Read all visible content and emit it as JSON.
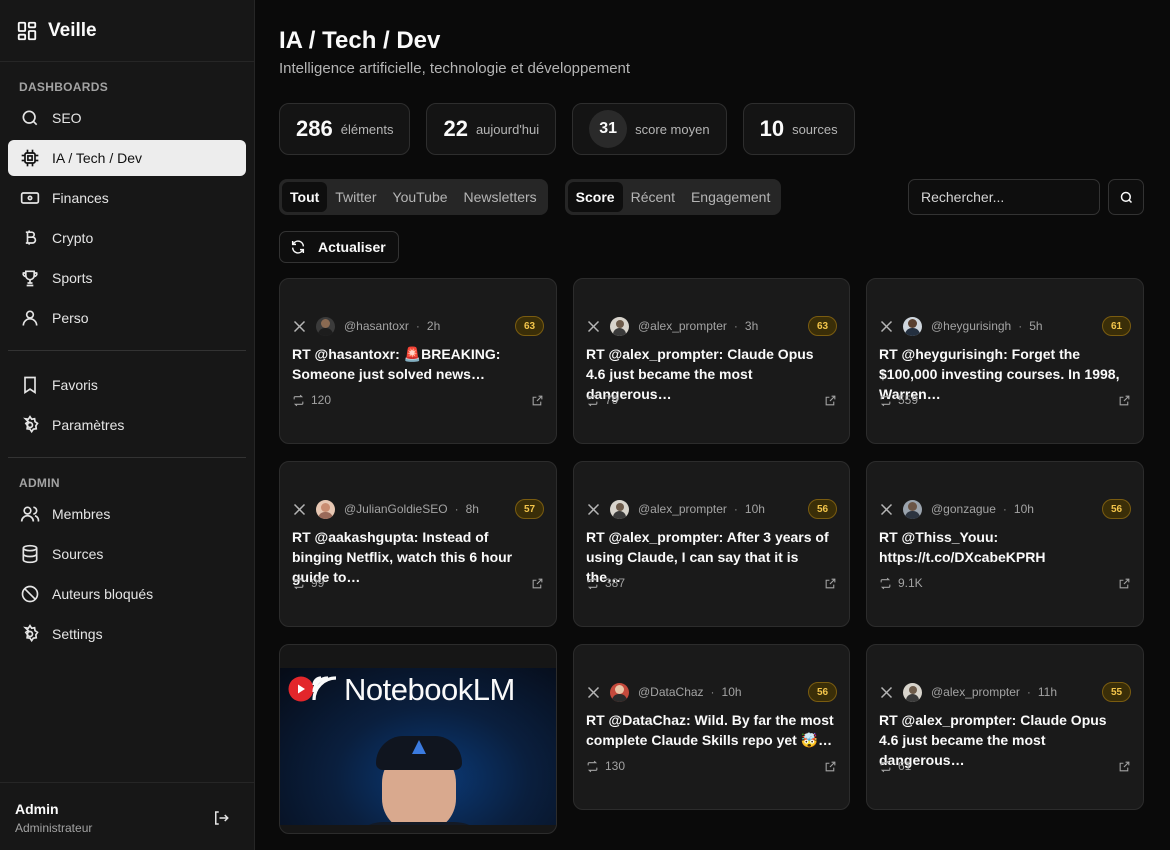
{
  "brand": {
    "name": "Veille"
  },
  "sidebar": {
    "dashboards_label": "DASHBOARDS",
    "dashboards": [
      {
        "label": "SEO",
        "icon": "search-icon"
      },
      {
        "label": "IA / Tech / Dev",
        "icon": "chip-icon",
        "active": true
      },
      {
        "label": "Finances",
        "icon": "banknote-icon"
      },
      {
        "label": "Crypto",
        "icon": "bitcoin-icon"
      },
      {
        "label": "Sports",
        "icon": "trophy-icon"
      },
      {
        "label": "Perso",
        "icon": "user-icon"
      }
    ],
    "other": [
      {
        "label": "Favoris",
        "icon": "bookmark-icon"
      },
      {
        "label": "Paramètres",
        "icon": "settings-icon"
      }
    ],
    "admin_label": "ADMIN",
    "admin": [
      {
        "label": "Membres",
        "icon": "users-icon"
      },
      {
        "label": "Sources",
        "icon": "database-icon"
      },
      {
        "label": "Auteurs bloqués",
        "icon": "ban-icon"
      },
      {
        "label": "Settings",
        "icon": "settings-icon"
      }
    ],
    "user": {
      "name": "Admin",
      "role": "Administrateur"
    }
  },
  "header": {
    "title": "IA / Tech / Dev",
    "subtitle": "Intelligence artificielle, technologie et développement"
  },
  "stats": [
    {
      "value": "286",
      "label": "éléments"
    },
    {
      "value": "22",
      "label": "aujourd'hui"
    },
    {
      "value": "31",
      "label": "score moyen"
    },
    {
      "value": "10",
      "label": "sources"
    }
  ],
  "filters": {
    "source_tabs": [
      "Tout",
      "Twitter",
      "YouTube",
      "Newsletters"
    ],
    "source_active": "Tout",
    "sort_tabs": [
      "Score",
      "Récent",
      "Engagement"
    ],
    "sort_active": "Score",
    "search_placeholder": "Rechercher...",
    "refresh_label": "Actualiser"
  },
  "colors": {
    "badge_bg": "#3a2e08",
    "badge_text": "#f3c54b",
    "active_nav": "#ededed"
  },
  "cards": [
    {
      "handle": "@hasantoxr",
      "age": "2h",
      "score": "63",
      "text": "RT @hasantoxr: 🚨BREAKING: Someone just solved news…",
      "retweets": "120"
    },
    {
      "handle": "@alex_prompter",
      "age": "3h",
      "score": "63",
      "text": "RT @alex_prompter: Claude Opus 4.6 just became the most dangerous…",
      "retweets": "79"
    },
    {
      "handle": "@heygurisingh",
      "age": "5h",
      "score": "61",
      "text": "RT @heygurisingh: Forget the $100,000 investing courses. In 1998, Warren…",
      "retweets": "559"
    },
    {
      "handle": "@JulianGoldieSEO",
      "age": "8h",
      "score": "57",
      "text": "RT @aakashgupta: Instead of binging Netflix, watch this 6 hour guide to…",
      "retweets": "99"
    },
    {
      "handle": "@alex_prompter",
      "age": "10h",
      "score": "56",
      "text": "RT @alex_prompter: After 3 years of using Claude, I can say that it is the…",
      "retweets": "387"
    },
    {
      "handle": "@gonzague",
      "age": "10h",
      "score": "56",
      "text": "RT @Thiss_Youu: https://t.co/DXcabeKPRH",
      "retweets": "9.1K"
    },
    {
      "video": true,
      "thumb_title": "NotebookLM"
    },
    {
      "handle": "@DataChaz",
      "age": "10h",
      "score": "56",
      "text": "RT @DataChaz: Wild. By far the most complete Claude Skills repo yet 🤯…",
      "retweets": "130"
    },
    {
      "handle": "@alex_prompter",
      "age": "11h",
      "score": "55",
      "text": "RT @alex_prompter: Claude Opus 4.6 just became the most dangerous…",
      "retweets": "61"
    }
  ]
}
